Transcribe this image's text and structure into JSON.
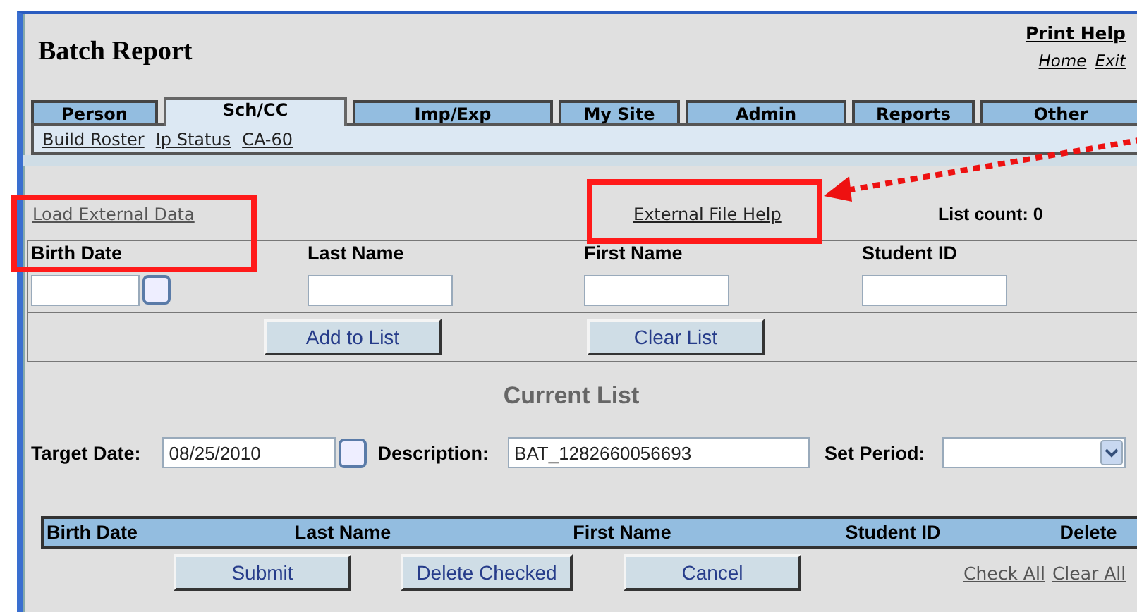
{
  "header": {
    "title": "Batch Report",
    "print_help": "Print Help",
    "links": [
      "Home",
      "Exit"
    ]
  },
  "tabs": [
    {
      "label": "Person",
      "selected": false
    },
    {
      "label": "Sch/CC",
      "selected": true
    },
    {
      "label": "Imp/Exp",
      "selected": false
    },
    {
      "label": "My Site",
      "selected": false
    },
    {
      "label": "Admin",
      "selected": false
    },
    {
      "label": "Reports",
      "selected": false
    },
    {
      "label": "Other",
      "selected": false
    }
  ],
  "subnav": [
    "Build Roster",
    "Ip Status",
    "CA-60"
  ],
  "load_link": "Load External Data",
  "help_link": "External File Help",
  "list_count": "List count: 0",
  "entry": {
    "fields": [
      {
        "label": "Birth Date",
        "kind": "date"
      },
      {
        "label": "Last Name",
        "kind": "text"
      },
      {
        "label": "First Name",
        "kind": "text"
      },
      {
        "label": "Student ID",
        "kind": "text"
      }
    ],
    "buttons": [
      "Add to List",
      "Clear List"
    ]
  },
  "current_list": {
    "title": "Current List",
    "target_date_label": "Target Date:",
    "target_date": "08/25/2010",
    "description_label": "Description:",
    "description": "BAT_1282660056693",
    "period_label": "Set Period:",
    "columns": [
      "Birth Date",
      "Last Name",
      "First Name",
      "Student ID",
      "Delete"
    ],
    "buttons": [
      "Submit",
      "Delete Checked",
      "Cancel"
    ],
    "links": [
      "Check All",
      "Clear All"
    ]
  }
}
